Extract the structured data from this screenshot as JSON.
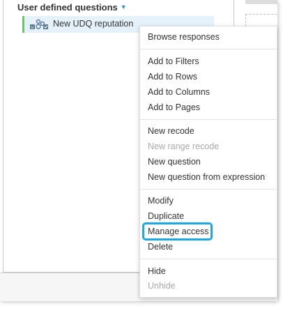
{
  "section": {
    "title": "User defined questions"
  },
  "tree": {
    "item_label": "New UDQ reputation",
    "item_icon": "udq-node-icon"
  },
  "context_menu": {
    "groups": [
      [
        {
          "label": "Browse responses",
          "enabled": true
        }
      ],
      [
        {
          "label": "Add to Filters",
          "enabled": true
        },
        {
          "label": "Add to Rows",
          "enabled": true
        },
        {
          "label": "Add to Columns",
          "enabled": true
        },
        {
          "label": "Add to Pages",
          "enabled": true
        }
      ],
      [
        {
          "label": "New recode",
          "enabled": true
        },
        {
          "label": "New range recode",
          "enabled": false
        },
        {
          "label": "New question",
          "enabled": true
        },
        {
          "label": "New question from expression",
          "enabled": true
        }
      ],
      [
        {
          "label": "Modify",
          "enabled": true
        },
        {
          "label": "Duplicate",
          "enabled": true
        },
        {
          "label": "Manage access",
          "enabled": true,
          "highlighted": true
        },
        {
          "label": "Delete",
          "enabled": true
        }
      ],
      [
        {
          "label": "Hide",
          "enabled": true
        },
        {
          "label": "Unhide",
          "enabled": false
        }
      ]
    ]
  },
  "colors": {
    "accent": "#1fa8e0",
    "selection": "#e6f2fb",
    "tree_marker": "#6cc36a"
  }
}
